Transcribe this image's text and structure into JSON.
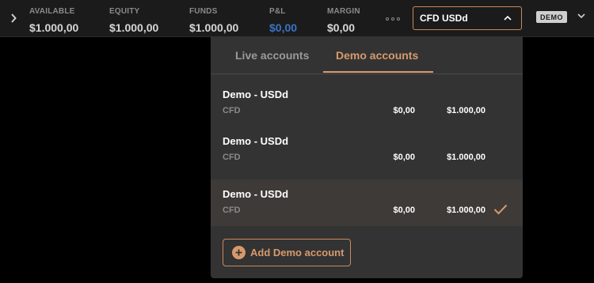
{
  "stats": [
    {
      "label": "AVAILABLE",
      "value": "$1.000,00"
    },
    {
      "label": "EQUITY",
      "value": "$1.000,00"
    },
    {
      "label": "FUNDS",
      "value": "$1.000,00"
    },
    {
      "label": "P&L",
      "value": "$0,00"
    },
    {
      "label": "MARGIN",
      "value": "$0,00"
    }
  ],
  "account_selector": {
    "label": "CFD USDd"
  },
  "mode_badge": "DEMO",
  "tabs": [
    {
      "label": "Live accounts",
      "active": false
    },
    {
      "label": "Demo accounts",
      "active": true
    }
  ],
  "accounts": [
    {
      "name": "Demo - USDd",
      "type": "CFD",
      "pl": "$0,00",
      "balance": "$1.000,00",
      "selected": false
    },
    {
      "name": "Demo - USDd",
      "type": "CFD",
      "pl": "$0,00",
      "balance": "$1.000,00",
      "selected": false
    },
    {
      "name": "Demo - USDd",
      "type": "CFD",
      "pl": "$0,00",
      "balance": "$1.000,00",
      "selected": true
    }
  ],
  "add_button": {
    "label": "Add Demo account"
  },
  "colors": {
    "accent": "#d79a6c",
    "pl_value": "#3a73c4",
    "panel": "#333333",
    "topbar": "#1b1b1b"
  },
  "icons": {
    "collapse": "chevron-right-icon",
    "more": "more-dots-icon",
    "select": "chevron-up-icon",
    "badge": "chevron-down-icon",
    "selected": "checkmark-icon",
    "add": "plus-circle-icon"
  }
}
